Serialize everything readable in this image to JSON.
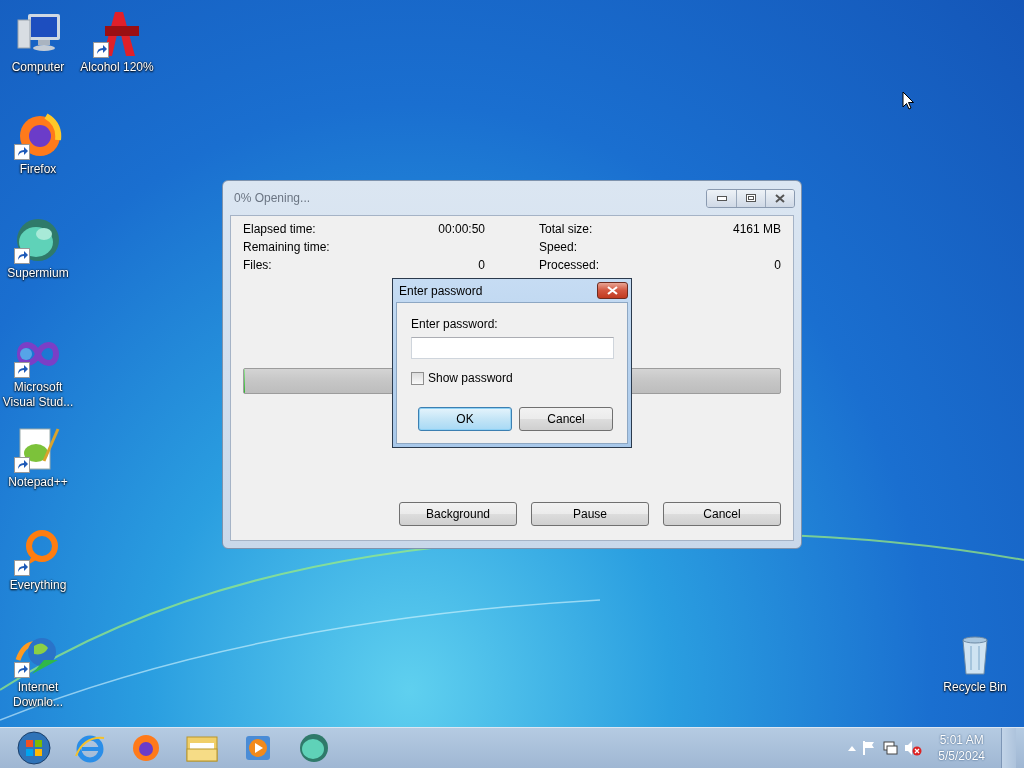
{
  "desktop_icons": [
    {
      "label": "Computer",
      "shortcut": false
    },
    {
      "label": "Alcohol 120%",
      "shortcut": true
    },
    {
      "label": "Firefox",
      "shortcut": true
    },
    {
      "label": "Supermium",
      "shortcut": true
    },
    {
      "label": "Microsoft Visual Stud...",
      "shortcut": true
    },
    {
      "label": "Notepad++",
      "shortcut": true
    },
    {
      "label": "Everything",
      "shortcut": true
    },
    {
      "label": "Internet Downlo...",
      "shortcut": true
    },
    {
      "label": "Recycle Bin",
      "shortcut": false
    }
  ],
  "progress_window": {
    "title": "0% Opening...",
    "stats": [
      [
        {
          "label": "Elapsed time:",
          "value": "00:00:50"
        },
        {
          "label": "Remaining time:"
        },
        {
          "label": "Files:",
          "value": "0"
        }
      ],
      [
        {
          "label": "Total size:",
          "value": "4161 MB"
        },
        {
          "label": "Speed:"
        },
        {
          "label": "Processed:",
          "value": "0"
        }
      ]
    ],
    "progress": {
      "level": 0
    },
    "buttons": [
      "Background",
      "Pause",
      "Cancel"
    ]
  },
  "password_dialog": {
    "title": "Enter password",
    "label": "Enter password:",
    "show_password": {
      "label": "Show password",
      "checked": false
    },
    "buttons": [
      {
        "label": "OK",
        "default": true
      },
      {
        "label": "Cancel",
        "default": false
      }
    ]
  },
  "taskbar": {
    "time": "5:01 AM",
    "date": "5/5/2024"
  }
}
